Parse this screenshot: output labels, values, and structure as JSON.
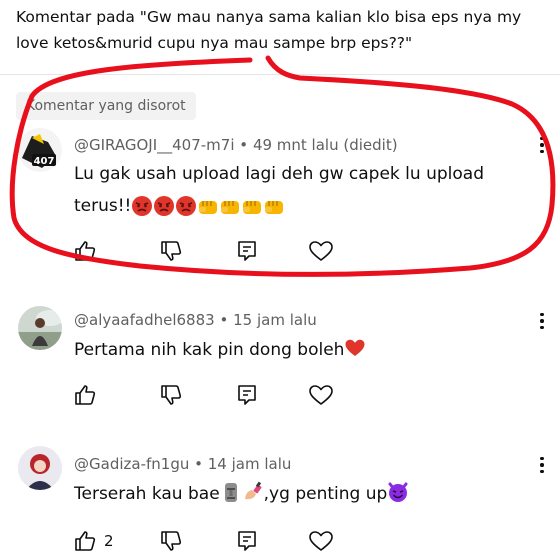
{
  "context": {
    "text": "Komentar pada \"Gw mau nanya sama kalian klo bisa eps nya my love ketos&murid cupu nya mau sampe brp eps??\""
  },
  "highlight_chip": "Komentar yang disorot",
  "comments": [
    {
      "author": "@GIRAGOJI__407-m7i",
      "meta": "49 mnt lalu (diedit)",
      "text": "Lu gak usah upload lagi deh gw capek lu upload terus!!",
      "emoji": [
        "angry-face",
        "angry-face",
        "angry-face",
        "fist",
        "fist",
        "fist",
        "fist"
      ],
      "likes": ""
    },
    {
      "author": "@alyaafadhel6883",
      "meta": "15 jam lalu",
      "text": "Pertama nih kak pin dong boleh",
      "emoji": [
        "red-heart"
      ],
      "likes": ""
    },
    {
      "author": "@Gadiza-fn1gu",
      "meta": "14 jam lalu",
      "text_before": "Terserah kau bae",
      "text_after": ",yg penting up",
      "emoji": [
        "moai",
        "nail-polish",
        "smiling-devil"
      ],
      "likes": "2"
    }
  ],
  "separator": "•",
  "colors": {
    "annotation_red": "#e8101c",
    "angry_red": "#e0352b",
    "fist_yellow": "#f7b500"
  }
}
